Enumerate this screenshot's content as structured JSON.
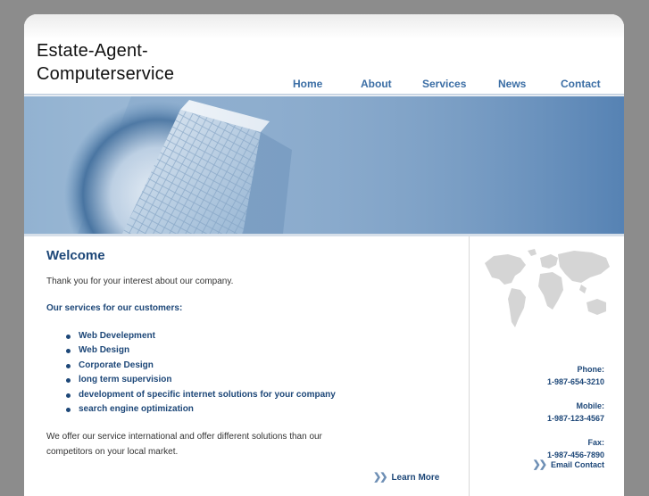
{
  "site": {
    "title_line1": "Estate-Agent-",
    "title_line2": "Computerservice"
  },
  "nav": {
    "items": [
      {
        "label": "Home"
      },
      {
        "label": "About"
      },
      {
        "label": "Services"
      },
      {
        "label": "News"
      },
      {
        "label": "Contact"
      }
    ]
  },
  "main": {
    "heading": "Welcome",
    "intro": "Thank you for your interest about our company.",
    "services_heading": "Our services for our customers:",
    "services": [
      "Web Develepment",
      "Web Design",
      "Corporate Design",
      "long term supervision",
      "development of specific internet solutions for your company",
      "search engine optimization"
    ],
    "outro": "We offer our service international and offer different solutions than our competitors on your local market.",
    "learn_more": "Learn More"
  },
  "sidebar": {
    "phone_label": "Phone:",
    "phone": "1-987-654-3210",
    "mobile_label": "Mobile:",
    "mobile": "1-987-123-4567",
    "fax_label": "Fax:",
    "fax": "1-987-456-7890",
    "email_link": "Email Contact"
  },
  "colors": {
    "accent": "#1d4778",
    "nav": "#3b6ea5",
    "banner": "#5c8cbc",
    "frame": "#8c8c8c"
  }
}
